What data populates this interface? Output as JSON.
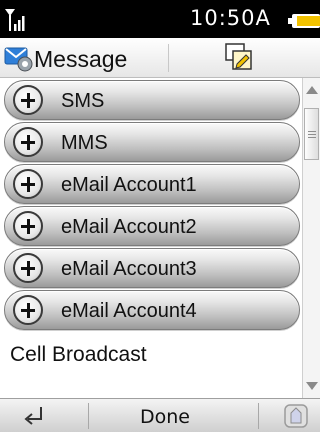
{
  "status_bar": {
    "time": "10:50A",
    "signal_icon": "signal-strength-icon",
    "battery_icon": "battery-icon"
  },
  "header": {
    "title": "Message",
    "app_icon": "message-settings-icon",
    "edit_icon": "compose-edit-icon"
  },
  "list": {
    "expandable_items": [
      {
        "label": "SMS"
      },
      {
        "label": "MMS"
      },
      {
        "label": "eMail Account1"
      },
      {
        "label": "eMail Account2"
      },
      {
        "label": "eMail Account3"
      },
      {
        "label": "eMail Account4"
      }
    ],
    "plain_item": "Cell Broadcast"
  },
  "bottom_bar": {
    "done_label": "Done",
    "back_icon": "back-arrow-icon",
    "home_icon": "home-icon"
  },
  "colors": {
    "status_bar_bg": "#000000",
    "battery_fill": "#f2c200",
    "edit_icon_accent": "#f2c200",
    "app_icon_blue": "#2f7fd8"
  }
}
